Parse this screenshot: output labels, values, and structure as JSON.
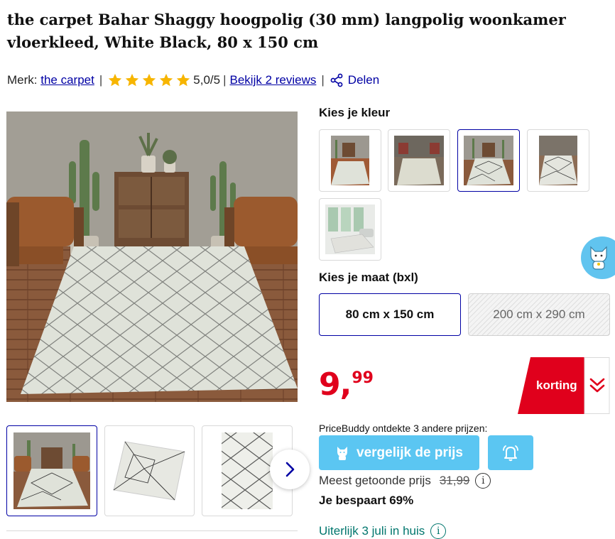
{
  "product": {
    "title": "the carpet Bahar Shaggy hoogpolig (30 mm) langpolig woonkamer vloerkleed, White Black, 80 x 150 cm"
  },
  "meta": {
    "brand_prefix": "Merk:",
    "brand": "the carpet",
    "separator": "|",
    "rating_value": 5,
    "rating_max": 5,
    "rating_text": "5,0/5",
    "reviews_link": "Bekijk 2 reviews",
    "share_label": "Delen"
  },
  "gallery": {
    "thumb_count": 3,
    "active_index": 0,
    "next_icon": "chevron-right-icon"
  },
  "color_select": {
    "label": "Kies je kleur",
    "option_count": 5,
    "selected_index": 2
  },
  "size_select": {
    "label": "Kies je maat (bxl)",
    "options": [
      {
        "label": "80 cm x 150 cm",
        "state": "selected"
      },
      {
        "label": "200 cm x 290 cm",
        "state": "unavailable"
      }
    ]
  },
  "price": {
    "integer": "9,",
    "decimals": "99",
    "badge_label": "korting",
    "badge_color": "#e0001c"
  },
  "pricebuddy": {
    "intro": "PriceBuddy ontdekte 3 andere prijzen:",
    "compare_label": "vergelijk de prijs",
    "alert_icon": "bell-icon",
    "accent": "#5bc6f2"
  },
  "savings": {
    "most_shown_label": "Meest getoonde prijs",
    "most_shown_price": "31,99",
    "saving_text": "Je bespaart 69%"
  },
  "delivery": {
    "text": "Uiterlijk 3 juli in huis"
  },
  "colors": {
    "link": "#0000a4",
    "star": "#f7b500",
    "price": "#e0001c",
    "delivery": "#00766d"
  }
}
